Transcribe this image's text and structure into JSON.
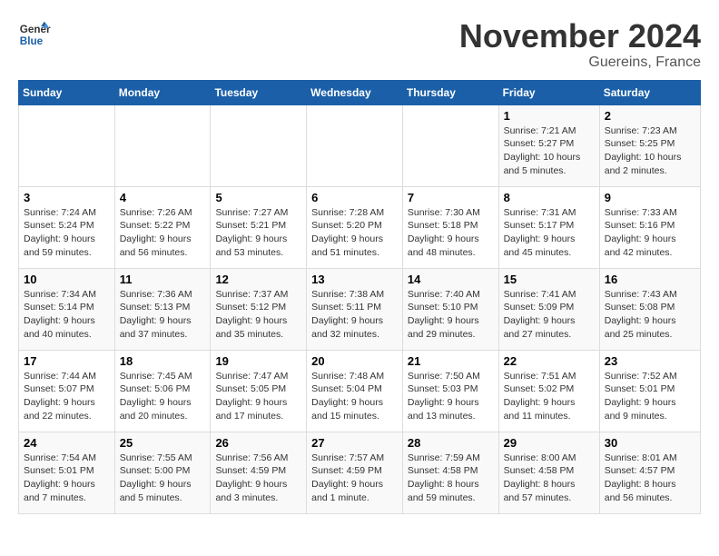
{
  "header": {
    "logo_line1": "General",
    "logo_line2": "Blue",
    "month": "November 2024",
    "location": "Guereins, France"
  },
  "weekdays": [
    "Sunday",
    "Monday",
    "Tuesday",
    "Wednesday",
    "Thursday",
    "Friday",
    "Saturday"
  ],
  "weeks": [
    [
      {
        "day": "",
        "info": ""
      },
      {
        "day": "",
        "info": ""
      },
      {
        "day": "",
        "info": ""
      },
      {
        "day": "",
        "info": ""
      },
      {
        "day": "",
        "info": ""
      },
      {
        "day": "1",
        "info": "Sunrise: 7:21 AM\nSunset: 5:27 PM\nDaylight: 10 hours\nand 5 minutes."
      },
      {
        "day": "2",
        "info": "Sunrise: 7:23 AM\nSunset: 5:25 PM\nDaylight: 10 hours\nand 2 minutes."
      }
    ],
    [
      {
        "day": "3",
        "info": "Sunrise: 7:24 AM\nSunset: 5:24 PM\nDaylight: 9 hours\nand 59 minutes."
      },
      {
        "day": "4",
        "info": "Sunrise: 7:26 AM\nSunset: 5:22 PM\nDaylight: 9 hours\nand 56 minutes."
      },
      {
        "day": "5",
        "info": "Sunrise: 7:27 AM\nSunset: 5:21 PM\nDaylight: 9 hours\nand 53 minutes."
      },
      {
        "day": "6",
        "info": "Sunrise: 7:28 AM\nSunset: 5:20 PM\nDaylight: 9 hours\nand 51 minutes."
      },
      {
        "day": "7",
        "info": "Sunrise: 7:30 AM\nSunset: 5:18 PM\nDaylight: 9 hours\nand 48 minutes."
      },
      {
        "day": "8",
        "info": "Sunrise: 7:31 AM\nSunset: 5:17 PM\nDaylight: 9 hours\nand 45 minutes."
      },
      {
        "day": "9",
        "info": "Sunrise: 7:33 AM\nSunset: 5:16 PM\nDaylight: 9 hours\nand 42 minutes."
      }
    ],
    [
      {
        "day": "10",
        "info": "Sunrise: 7:34 AM\nSunset: 5:14 PM\nDaylight: 9 hours\nand 40 minutes."
      },
      {
        "day": "11",
        "info": "Sunrise: 7:36 AM\nSunset: 5:13 PM\nDaylight: 9 hours\nand 37 minutes."
      },
      {
        "day": "12",
        "info": "Sunrise: 7:37 AM\nSunset: 5:12 PM\nDaylight: 9 hours\nand 35 minutes."
      },
      {
        "day": "13",
        "info": "Sunrise: 7:38 AM\nSunset: 5:11 PM\nDaylight: 9 hours\nand 32 minutes."
      },
      {
        "day": "14",
        "info": "Sunrise: 7:40 AM\nSunset: 5:10 PM\nDaylight: 9 hours\nand 29 minutes."
      },
      {
        "day": "15",
        "info": "Sunrise: 7:41 AM\nSunset: 5:09 PM\nDaylight: 9 hours\nand 27 minutes."
      },
      {
        "day": "16",
        "info": "Sunrise: 7:43 AM\nSunset: 5:08 PM\nDaylight: 9 hours\nand 25 minutes."
      }
    ],
    [
      {
        "day": "17",
        "info": "Sunrise: 7:44 AM\nSunset: 5:07 PM\nDaylight: 9 hours\nand 22 minutes."
      },
      {
        "day": "18",
        "info": "Sunrise: 7:45 AM\nSunset: 5:06 PM\nDaylight: 9 hours\nand 20 minutes."
      },
      {
        "day": "19",
        "info": "Sunrise: 7:47 AM\nSunset: 5:05 PM\nDaylight: 9 hours\nand 17 minutes."
      },
      {
        "day": "20",
        "info": "Sunrise: 7:48 AM\nSunset: 5:04 PM\nDaylight: 9 hours\nand 15 minutes."
      },
      {
        "day": "21",
        "info": "Sunrise: 7:50 AM\nSunset: 5:03 PM\nDaylight: 9 hours\nand 13 minutes."
      },
      {
        "day": "22",
        "info": "Sunrise: 7:51 AM\nSunset: 5:02 PM\nDaylight: 9 hours\nand 11 minutes."
      },
      {
        "day": "23",
        "info": "Sunrise: 7:52 AM\nSunset: 5:01 PM\nDaylight: 9 hours\nand 9 minutes."
      }
    ],
    [
      {
        "day": "24",
        "info": "Sunrise: 7:54 AM\nSunset: 5:01 PM\nDaylight: 9 hours\nand 7 minutes."
      },
      {
        "day": "25",
        "info": "Sunrise: 7:55 AM\nSunset: 5:00 PM\nDaylight: 9 hours\nand 5 minutes."
      },
      {
        "day": "26",
        "info": "Sunrise: 7:56 AM\nSunset: 4:59 PM\nDaylight: 9 hours\nand 3 minutes."
      },
      {
        "day": "27",
        "info": "Sunrise: 7:57 AM\nSunset: 4:59 PM\nDaylight: 9 hours\nand 1 minute."
      },
      {
        "day": "28",
        "info": "Sunrise: 7:59 AM\nSunset: 4:58 PM\nDaylight: 8 hours\nand 59 minutes."
      },
      {
        "day": "29",
        "info": "Sunrise: 8:00 AM\nSunset: 4:58 PM\nDaylight: 8 hours\nand 57 minutes."
      },
      {
        "day": "30",
        "info": "Sunrise: 8:01 AM\nSunset: 4:57 PM\nDaylight: 8 hours\nand 56 minutes."
      }
    ]
  ]
}
